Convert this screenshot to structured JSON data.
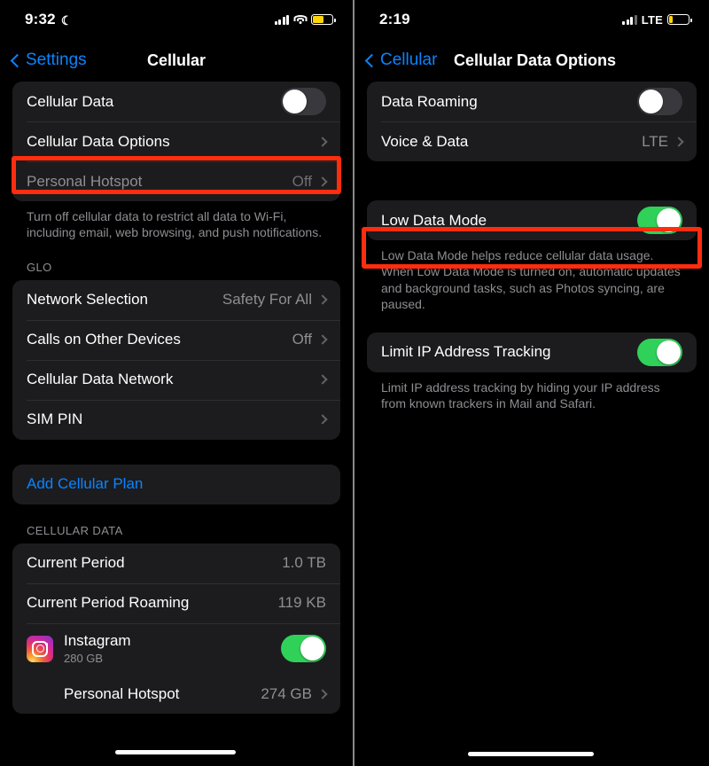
{
  "left": {
    "status": {
      "time": "9:32",
      "dnd_icon": "crescent-moon-icon",
      "signal_icon": "cellular-bars-icon",
      "wifi_icon": "wifi-icon",
      "battery_icon": "battery-low-power-icon",
      "battery_fill_pct": 55
    },
    "nav": {
      "back_label": "Settings",
      "title": "Cellular"
    },
    "group1": [
      {
        "label": "Cellular Data",
        "type": "toggle",
        "on": false
      },
      {
        "label": "Cellular Data Options",
        "type": "disclosure",
        "value": "",
        "highlighted": true
      },
      {
        "label": "Personal Hotspot",
        "type": "disclosure",
        "value": "Off",
        "disabled": true
      }
    ],
    "footer1": "Turn off cellular data to restrict all data to Wi-Fi, including email, web browsing, and push notifications.",
    "section2_header": "GLO",
    "group2": [
      {
        "label": "Network Selection",
        "type": "disclosure",
        "value": "Safety For All"
      },
      {
        "label": "Calls on Other Devices",
        "type": "disclosure",
        "value": "Off"
      },
      {
        "label": "Cellular Data Network",
        "type": "disclosure",
        "value": ""
      },
      {
        "label": "SIM PIN",
        "type": "disclosure",
        "value": ""
      }
    ],
    "add_plan_label": "Add Cellular Plan",
    "section4_header": "CELLULAR DATA",
    "group4": [
      {
        "label": "Current Period",
        "type": "value",
        "value": "1.0 TB"
      },
      {
        "label": "Current Period Roaming",
        "type": "value",
        "value": "119 KB"
      }
    ],
    "app_row": {
      "icon": "instagram-icon",
      "name": "Instagram",
      "usage": "280 GB",
      "toggle_on": true
    },
    "hotspot_row": {
      "label": "Personal Hotspot",
      "value": "274 GB"
    }
  },
  "right": {
    "status": {
      "time": "2:19",
      "signal_icon": "cellular-bars-icon",
      "network_label": "LTE",
      "battery_icon": "battery-low-icon",
      "battery_fill_pct": 20
    },
    "nav": {
      "back_label": "Cellular",
      "title": "Cellular Data Options"
    },
    "group1": [
      {
        "label": "Data Roaming",
        "type": "toggle",
        "on": false
      },
      {
        "label": "Voice & Data",
        "type": "disclosure",
        "value": "LTE"
      }
    ],
    "low_data_mode": {
      "label": "Low Data Mode",
      "on": true,
      "highlighted": true
    },
    "footer1": "Low Data Mode helps reduce cellular data usage. When Low Data Mode is turned on, automatic updates and background tasks, such as Photos syncing, are paused.",
    "limit_ip": {
      "label": "Limit IP Address Tracking",
      "on": true
    },
    "footer2": "Limit IP address tracking by hiding your IP address from known trackers in Mail and Safari."
  },
  "colors": {
    "accent_blue": "#0a84ff",
    "toggle_on_green": "#30d158",
    "highlight_red": "#ff2d0e",
    "battery_yellow": "#ffd60a",
    "cell_bg": "#1c1c1e"
  }
}
